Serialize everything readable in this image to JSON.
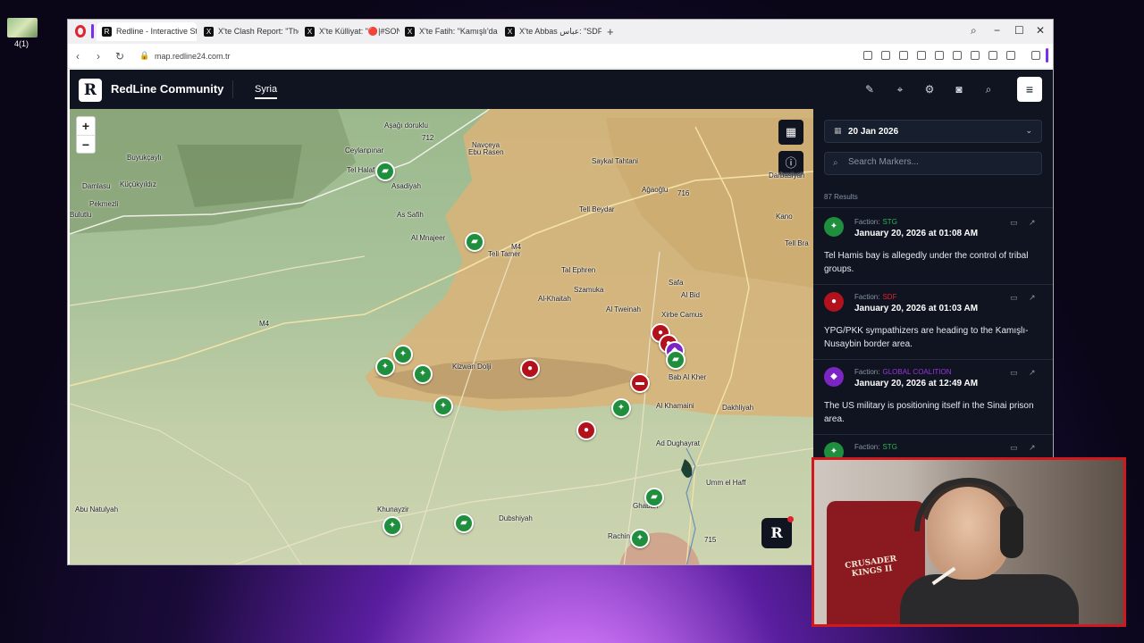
{
  "desktop": {
    "icon_label": "4(1)"
  },
  "browser": {
    "tabs": [
      {
        "label": "Redline - Interactive Strat",
        "active": true
      },
      {
        "label": "X'te Clash Report: \"The Sy"
      },
      {
        "label": "X'te Külliyat: \"🔴|#SONDA"
      },
      {
        "label": "X'te Fatih: \"Kamışlı'da top"
      },
      {
        "label": "X'te Abbas عباس: \"SDF's w"
      }
    ],
    "url": "map.redline24.com.tr"
  },
  "app": {
    "brand": "RedLine Community",
    "logo_letter": "R",
    "nav_tab": "Syria"
  },
  "map": {
    "zoom_in": "+",
    "zoom_out": "−",
    "places": [
      "Aşağı doruklu",
      "Ceylanpınar",
      "Tel Halaf",
      "Buyukçaylı",
      "Damlasu",
      "Küçükyıldız",
      "Pekmezli",
      "Bulutlu",
      "Asadiyah",
      "As Safih",
      "Al Mnajeer",
      "Tell Tamer",
      "Navçeya",
      "Ebu Rasen",
      "Saykal Tahtani",
      "Ağaoğlu",
      "Tell Beydar",
      "Kano",
      "Tell Bra",
      "Tal Ephren",
      "Szamuka",
      "Al-Khaitah",
      "Al Tweinah",
      "Safa",
      "Al Bid",
      "Xirbe Camus",
      "Kizwan Dolji",
      "Bab Al Kher",
      "Al Khamaini",
      "Dakhliyah",
      "Ad Dughayrat",
      "Umm el Haff",
      "Ghabah",
      "Abu Natulyah",
      "Khunayzir",
      "Dubshiyah",
      "Rachin",
      "Darbasiyah"
    ],
    "road_labels": [
      "M4",
      "712",
      "M4",
      "715",
      "716"
    ]
  },
  "sidebar": {
    "date": "20 Jan 2026",
    "search_placeholder": "Search Markers...",
    "results": "87 Results",
    "items": [
      {
        "faction_label": "Faction:",
        "faction": "STG",
        "faction_color": "#2fb450",
        "badge_color": "#1f8f3e",
        "date": "January 20, 2026 at 01:08 AM",
        "text": "Tel Hamis bay is allegedly under the control of tribal groups."
      },
      {
        "faction_label": "Faction:",
        "faction": "SDF",
        "faction_color": "#e0232e",
        "badge_color": "#b3121c",
        "date": "January 20, 2026 at 01:03 AM",
        "text": "YPG/PKK sympathizers are heading to the Kamışlı-Nusaybin border area."
      },
      {
        "faction_label": "Faction:",
        "faction": "GLOBAL COALITION",
        "faction_color": "#9b33e0",
        "badge_color": "#7b25c4",
        "date": "January 20, 2026 at 12:49 AM",
        "text": "The US military is positioning itself in the Sinai prison area."
      },
      {
        "faction_label": "Faction:",
        "faction": "STG",
        "faction_color": "#2fb450",
        "badge_color": "#1f8f3e",
        "date": "",
        "text": ""
      }
    ]
  },
  "webcam": {
    "chair_text": "CRUSADER KINGS II"
  }
}
